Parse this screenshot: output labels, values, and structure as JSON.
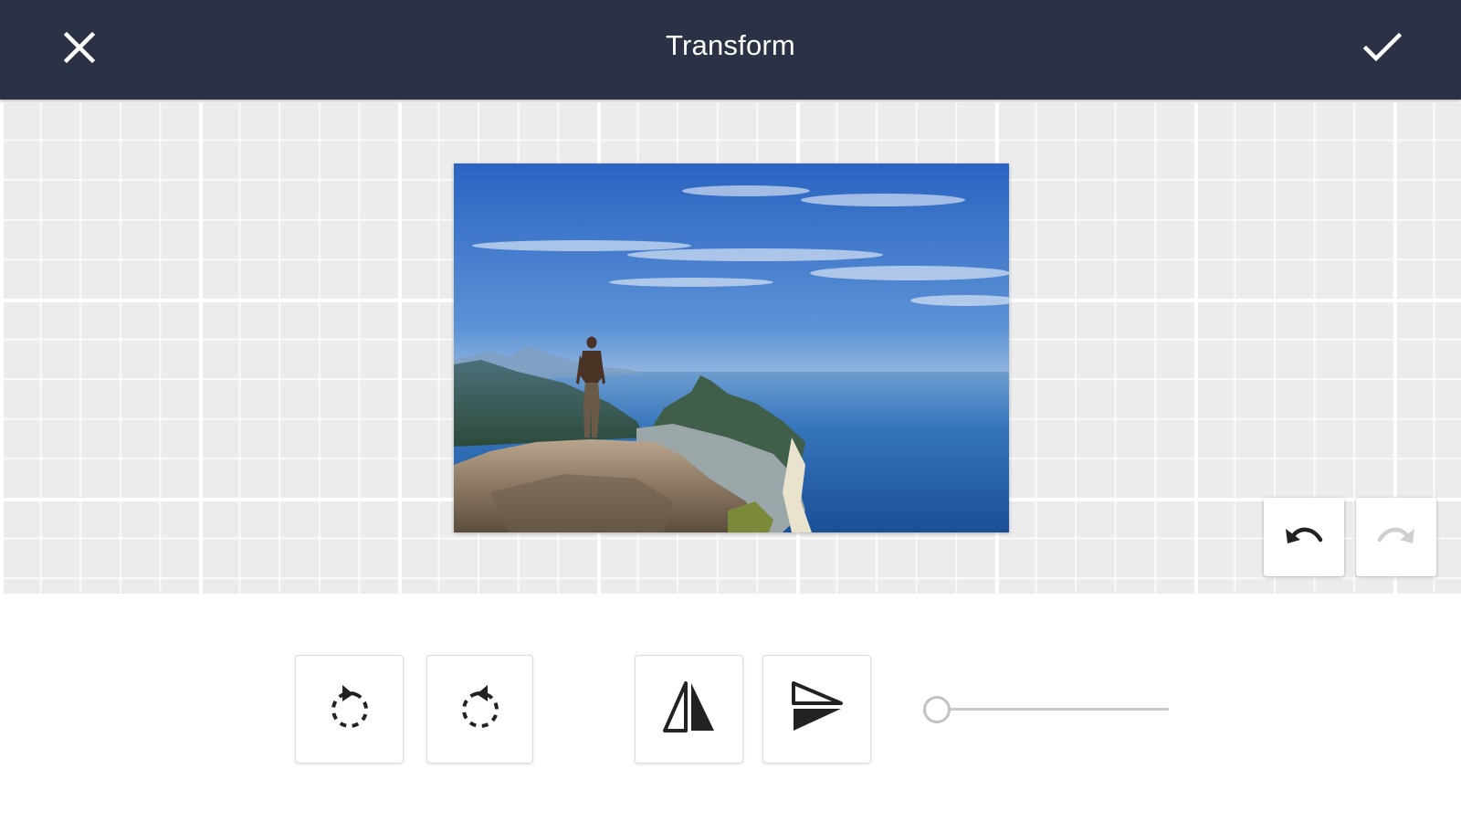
{
  "header": {
    "title": "Transform",
    "close_icon": "close-icon",
    "confirm_icon": "check-icon",
    "background": "#2b3245"
  },
  "canvas": {
    "background": "#ececec",
    "image": {
      "description_icon": "photo-image",
      "colors": {
        "sky": "#2f6fc8",
        "sea": "#1e5fae",
        "rock": "#8a7a66"
      }
    },
    "history": {
      "undo_icon": "undo-icon",
      "redo_icon": "redo-icon",
      "undo_enabled": true,
      "redo_enabled": false
    }
  },
  "toolbar": {
    "rotate_left_icon": "rotate-left-icon",
    "rotate_right_icon": "rotate-right-icon",
    "flip_horizontal_icon": "flip-horizontal-icon",
    "flip_vertical_icon": "flip-vertical-icon",
    "straighten_slider": {
      "value": 0,
      "min": 0,
      "max": 100
    }
  }
}
